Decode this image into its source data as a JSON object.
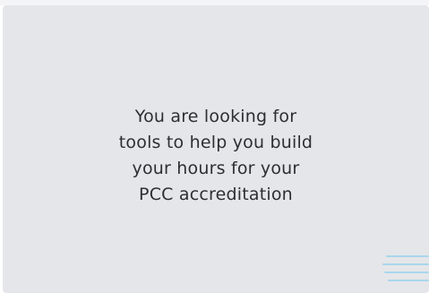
{
  "slide": {
    "lines": [
      "You are looking for",
      "tools to help you build",
      "your hours for your",
      "PCC accreditation"
    ]
  },
  "decoration": {
    "icon": "horizontal-lines-icon",
    "color": "#a9d6ec"
  }
}
